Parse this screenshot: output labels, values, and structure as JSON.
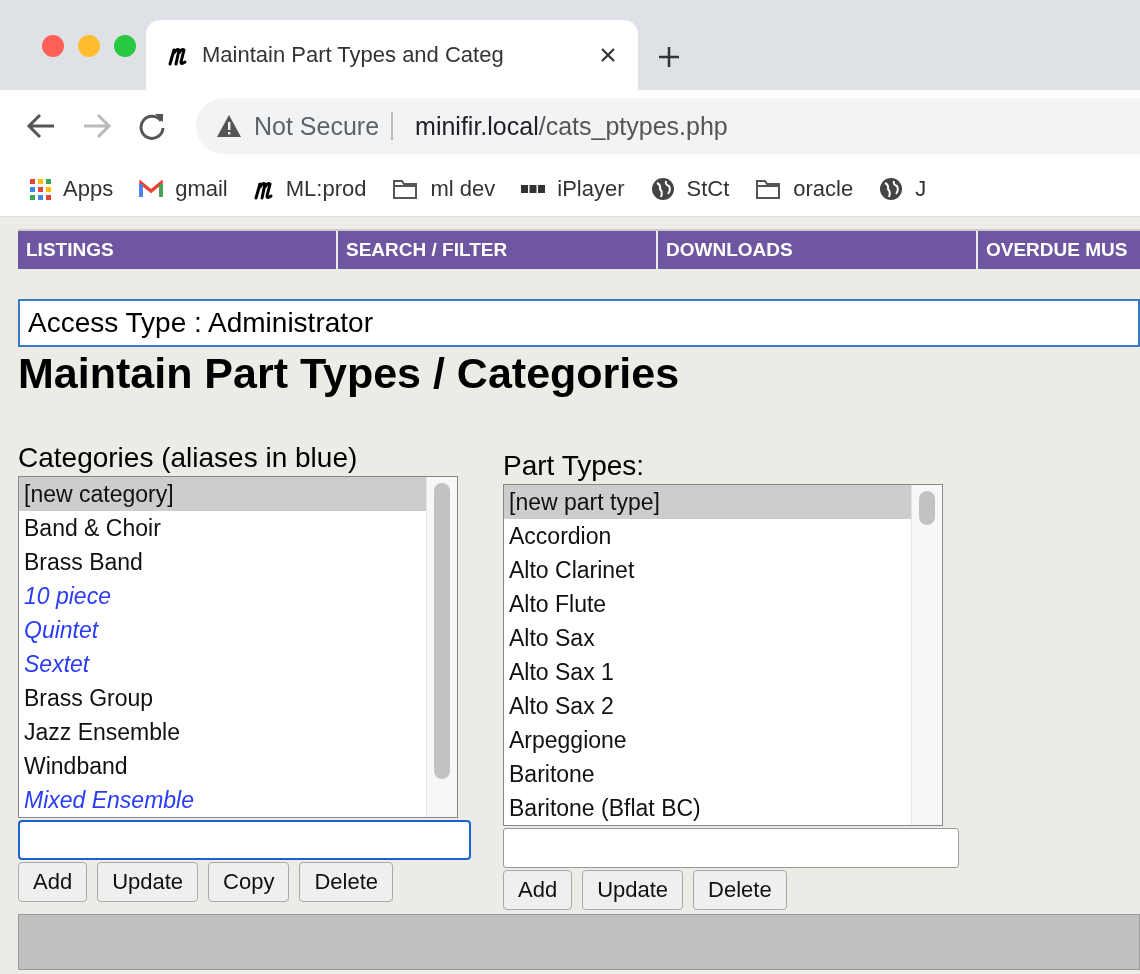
{
  "browser": {
    "tab_title": "Maintain Part Types and Categ",
    "security": "Not Secure",
    "url_host": "minifir.local",
    "url_path": "/cats_ptypes.php",
    "bookmarks": [
      {
        "kind": "apps",
        "label": "Apps"
      },
      {
        "kind": "gmail",
        "label": "gmail"
      },
      {
        "kind": "logo",
        "label": "ML:prod"
      },
      {
        "kind": "folder",
        "label": "ml dev"
      },
      {
        "kind": "iplayer",
        "label": "iPlayer"
      },
      {
        "kind": "globe",
        "label": "StCt"
      },
      {
        "kind": "folder",
        "label": "oracle"
      },
      {
        "kind": "globe",
        "label": "J"
      }
    ]
  },
  "nav": [
    "LISTINGS",
    "SEARCH / FILTER",
    "DOWNLOADS",
    "OVERDUE MUS"
  ],
  "access_type": "Access Type : Administrator",
  "heading": "Maintain Part Types / Categories",
  "panels": [
    {
      "label": "Categories (aliases in blue)",
      "input_focused": true,
      "items": [
        {
          "text": "[new category]",
          "selected": true,
          "alias": false
        },
        {
          "text": "Band & Choir",
          "selected": false,
          "alias": false
        },
        {
          "text": "Brass Band",
          "selected": false,
          "alias": false
        },
        {
          "text": "10 piece",
          "selected": false,
          "alias": true
        },
        {
          "text": "Quintet",
          "selected": false,
          "alias": true
        },
        {
          "text": "Sextet",
          "selected": false,
          "alias": true
        },
        {
          "text": "Brass Group",
          "selected": false,
          "alias": false
        },
        {
          "text": "Jazz Ensemble",
          "selected": false,
          "alias": false
        },
        {
          "text": "Windband",
          "selected": false,
          "alias": false
        },
        {
          "text": "Mixed Ensemble",
          "selected": false,
          "alias": true
        }
      ],
      "buttons": [
        "Add",
        "Update",
        "Copy",
        "Delete"
      ]
    },
    {
      "label": "Part Types:",
      "input_focused": false,
      "items": [
        {
          "text": "[new part type]",
          "selected": true,
          "alias": false
        },
        {
          "text": "Accordion",
          "selected": false,
          "alias": false
        },
        {
          "text": "Alto Clarinet",
          "selected": false,
          "alias": false
        },
        {
          "text": "Alto Flute",
          "selected": false,
          "alias": false
        },
        {
          "text": "Alto Sax",
          "selected": false,
          "alias": false
        },
        {
          "text": "Alto Sax 1",
          "selected": false,
          "alias": false
        },
        {
          "text": "Alto Sax 2",
          "selected": false,
          "alias": false
        },
        {
          "text": "Arpeggione",
          "selected": false,
          "alias": false
        },
        {
          "text": "Baritone",
          "selected": false,
          "alias": false
        },
        {
          "text": "Baritone (Bflat BC)",
          "selected": false,
          "alias": false
        }
      ],
      "buttons": [
        "Add",
        "Update",
        "Delete"
      ]
    }
  ]
}
